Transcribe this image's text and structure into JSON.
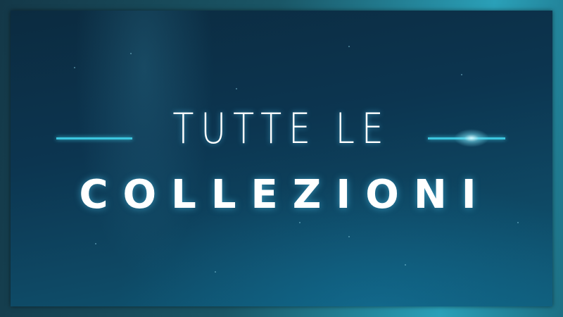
{
  "banner": {
    "title_line1": "TUTTE LE",
    "title_line2": "COLLEZIONI",
    "accent_color": "#3cc6df",
    "background_color": "#0c3550"
  }
}
